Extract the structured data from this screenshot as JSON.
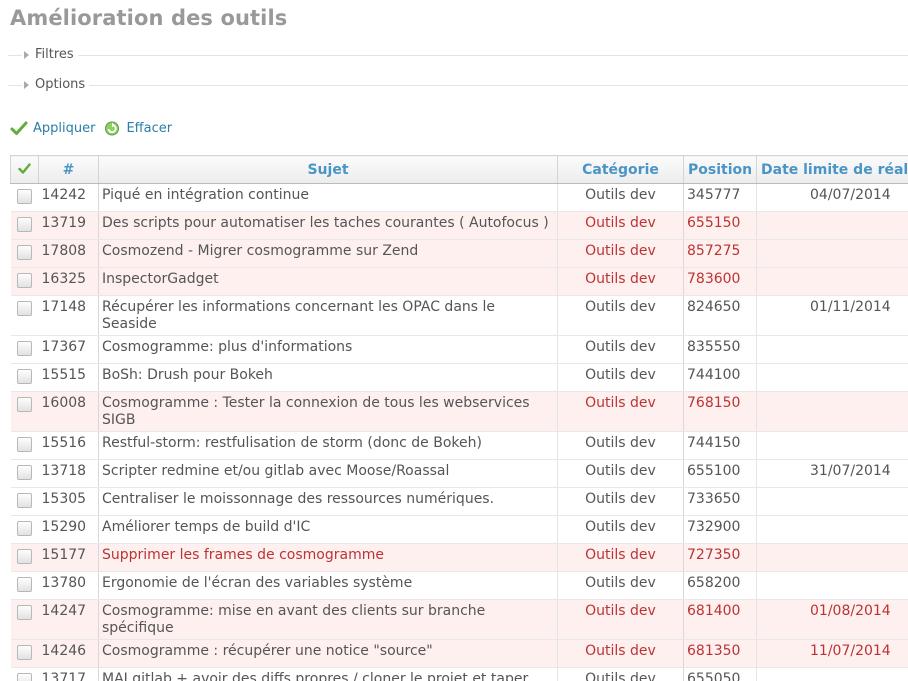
{
  "page": {
    "title": "Amélioration des outils"
  },
  "filters": {
    "label": "Filtres"
  },
  "options": {
    "label": "Options"
  },
  "actions": {
    "apply_label": "Appliquer",
    "clear_label": "Effacer",
    "apply_icon": "checkmark-icon",
    "clear_icon": "reload-icon"
  },
  "table": {
    "columns": {
      "check": "✔",
      "id": "#",
      "subject": "Sujet",
      "category": "Catégorie",
      "position": "Position",
      "due_date": "Date limite de réalis"
    },
    "rows": [
      {
        "id": "14242",
        "subject": "Piqué en intégration continue",
        "category": "Outils dev",
        "position": "345777",
        "due_date": "04/07/2014",
        "highlight": false
      },
      {
        "id": "13719",
        "subject": "Des scripts pour automatiser les taches courantes ( Autofocus )",
        "category": "Outils dev",
        "position": "655150",
        "due_date": "",
        "highlight": true
      },
      {
        "id": "17808",
        "subject": "Cosmozend - Migrer cosmogramme sur Zend",
        "category": "Outils dev",
        "position": "857275",
        "due_date": "",
        "highlight": true
      },
      {
        "id": "16325",
        "subject": "InspectorGadget",
        "category": "Outils dev",
        "position": "783600",
        "due_date": "",
        "highlight": true
      },
      {
        "id": "17148",
        "subject": "Récupérer les informations concernant les OPAC dans le Seaside",
        "category": "Outils dev",
        "position": "824650",
        "due_date": "01/11/2014",
        "highlight": false
      },
      {
        "id": "17367",
        "subject": "Cosmogramme: plus d'informations",
        "category": "Outils dev",
        "position": "835550",
        "due_date": "",
        "highlight": false
      },
      {
        "id": "15515",
        "subject": "BoSh: Drush pour Bokeh",
        "category": "Outils dev",
        "position": "744100",
        "due_date": "",
        "highlight": false
      },
      {
        "id": "16008",
        "subject": "Cosmogramme : Tester la connexion de tous les webservices SIGB",
        "category": "Outils dev",
        "position": "768150",
        "due_date": "",
        "highlight": true
      },
      {
        "id": "15516",
        "subject": "Restful-storm: restfulisation de storm (donc de Bokeh)",
        "category": "Outils dev",
        "position": "744150",
        "due_date": "",
        "highlight": false
      },
      {
        "id": "13718",
        "subject": "Scripter redmine et/ou gitlab avec Moose/Roassal",
        "category": "Outils dev",
        "position": "655100",
        "due_date": "31/07/2014",
        "highlight": false
      },
      {
        "id": "15305",
        "subject": "Centraliser le moissonnage des ressources numériques.",
        "category": "Outils dev",
        "position": "733650",
        "due_date": "",
        "highlight": false
      },
      {
        "id": "15290",
        "subject": "Améliorer temps de build d'IC",
        "category": "Outils dev",
        "position": "732900",
        "due_date": "",
        "highlight": false
      },
      {
        "id": "15177",
        "subject": "Supprimer les frames de cosmogramme",
        "category": "Outils dev",
        "position": "727350",
        "due_date": "",
        "highlight": true,
        "red_subject": true
      },
      {
        "id": "13780",
        "subject": "Ergonomie de l'écran des variables système",
        "category": "Outils dev",
        "position": "658200",
        "due_date": "",
        "highlight": false
      },
      {
        "id": "14247",
        "subject": "Cosmogramme: mise en avant des clients sur branche spécifique",
        "category": "Outils dev",
        "position": "681400",
        "due_date": "01/08/2014",
        "highlight": true
      },
      {
        "id": "14246",
        "subject": "Cosmogramme : récupérer une notice \"source\"",
        "category": "Outils dev",
        "position": "681350",
        "due_date": "11/07/2014",
        "highlight": true
      },
      {
        "id": "13717",
        "subject": "MAJ gitlab + avoir des diffs propres / cloner le projet et taper dedans",
        "category": "Outils dev",
        "position": "655050",
        "due_date": "",
        "highlight": false
      }
    ]
  },
  "colors": {
    "title": "#999999",
    "link": "#2a7ea7",
    "header_text": "#4a95c8",
    "highlight_bg": "#fff0f0",
    "highlight_text": "#bb3333"
  }
}
